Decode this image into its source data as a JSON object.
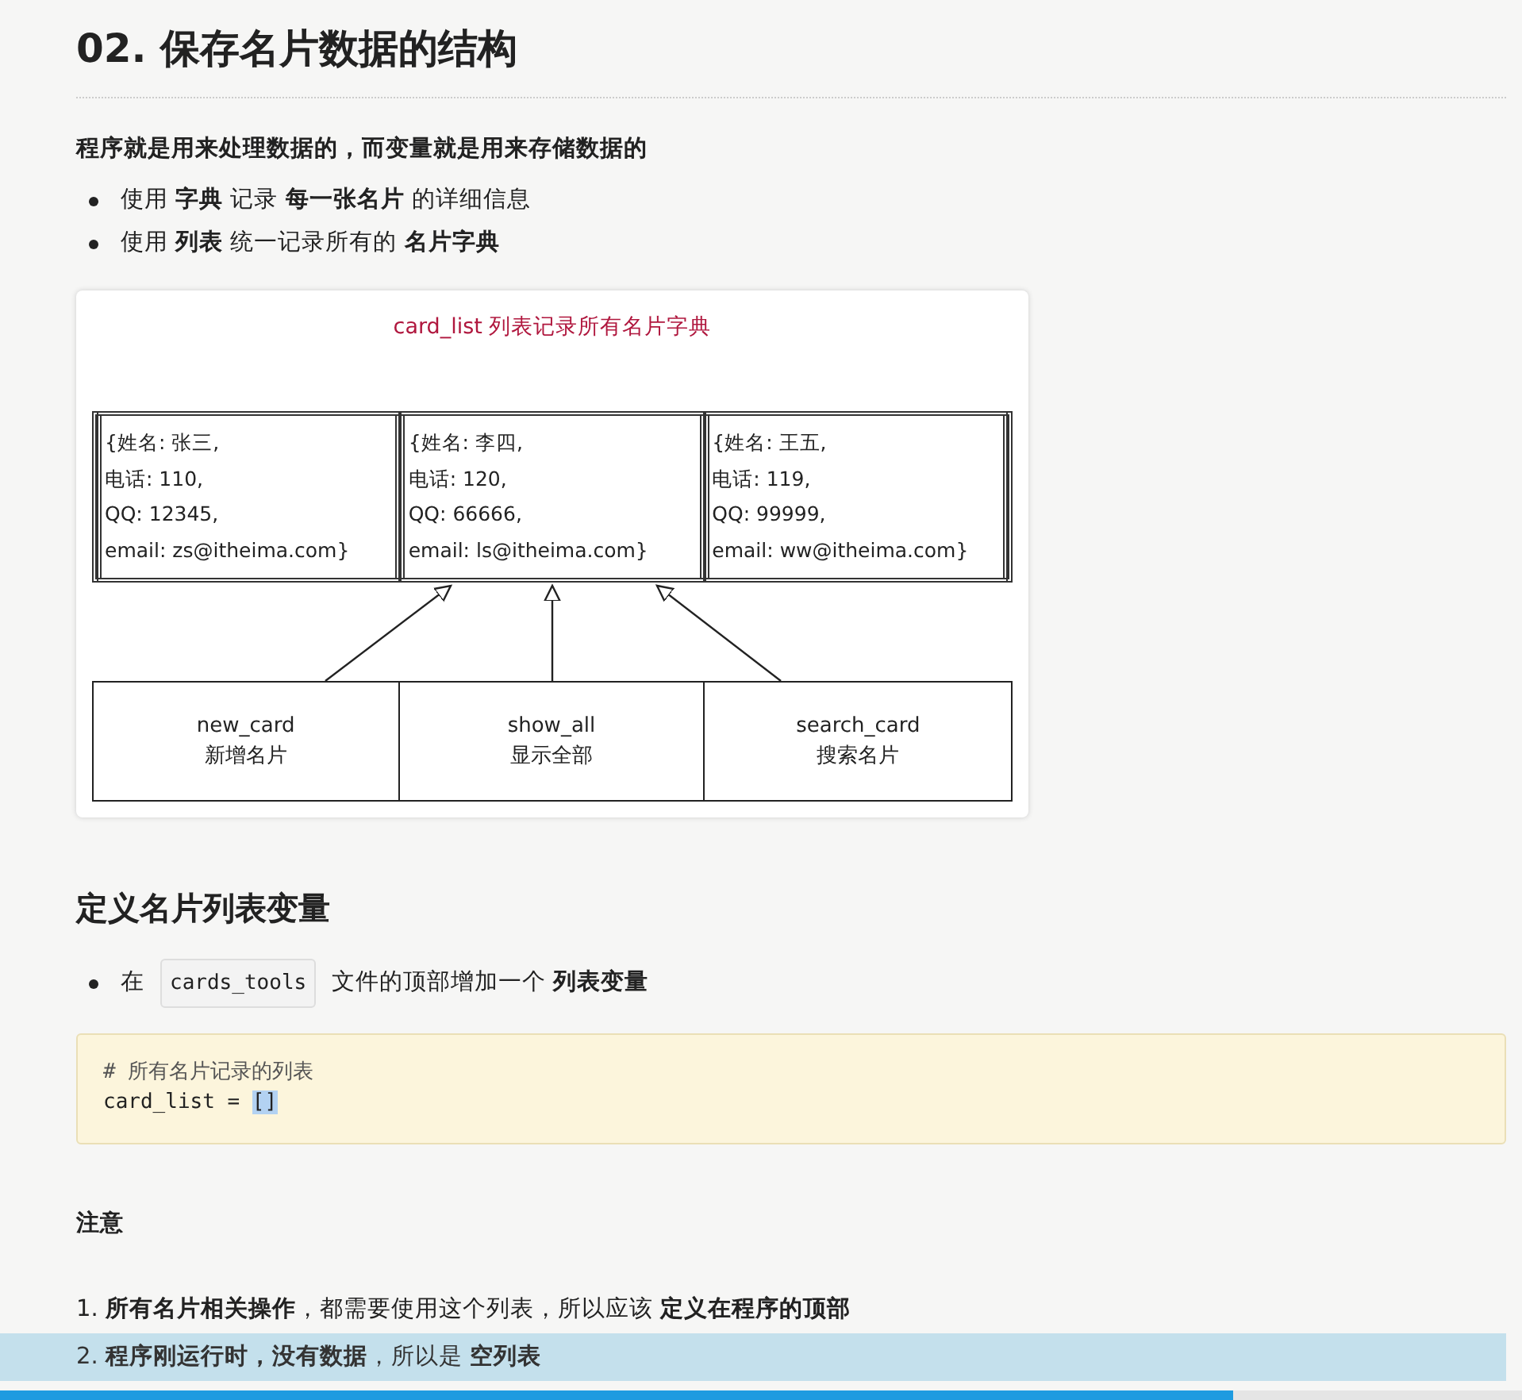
{
  "title": "02. 保存名片数据的结构",
  "intro": "程序就是用来处理数据的，而变量就是用来存储数据的",
  "bullets": [
    "使用 **字典** 记录 **每一张名片** 的详细信息",
    "使用 **列表** 统一记录所有的 **名片字典**"
  ],
  "diagram": {
    "title": "card_list 列表记录所有名片字典",
    "cards": [
      {
        "lines": [
          "{姓名: 张三,",
          "电话: 110,",
          "QQ: 12345,",
          "email: zs@itheima.com}"
        ]
      },
      {
        "lines": [
          "{姓名: 李四,",
          "电话: 120,",
          "QQ: 66666,",
          "email: ls@itheima.com}"
        ]
      },
      {
        "lines": [
          "{姓名: 王五,",
          "电话: 119,",
          "QQ: 99999,",
          "email: ww@itheima.com}"
        ]
      }
    ],
    "functions": [
      {
        "name": "new_card",
        "label": "新增名片"
      },
      {
        "name": "show_all",
        "label": "显示全部"
      },
      {
        "name": "search_card",
        "label": "搜索名片"
      }
    ]
  },
  "section_heading": "定义名片列表变量",
  "section_bullet": {
    "before": "在",
    "code": "cards_tools",
    "after": "文件的顶部增加一个 **列表变量**"
  },
  "code_lines": [
    {
      "kind": "comment",
      "text": "# 所有名片记录的列表"
    },
    {
      "kind": "code",
      "text": "card_list = ",
      "selected_text": "[]"
    }
  ],
  "note_heading": "注意",
  "notes": [
    {
      "number": "1.",
      "text": "**所有名片相关操作**，都需要使用这个列表，所以应该 **定义在程序的顶部**",
      "selected": false
    },
    {
      "number": "2.",
      "text": "**程序刚运行时，没有数据**，所以是 **空列表**",
      "selected": true
    }
  ],
  "video_progress": {
    "level": 0.81
  }
}
